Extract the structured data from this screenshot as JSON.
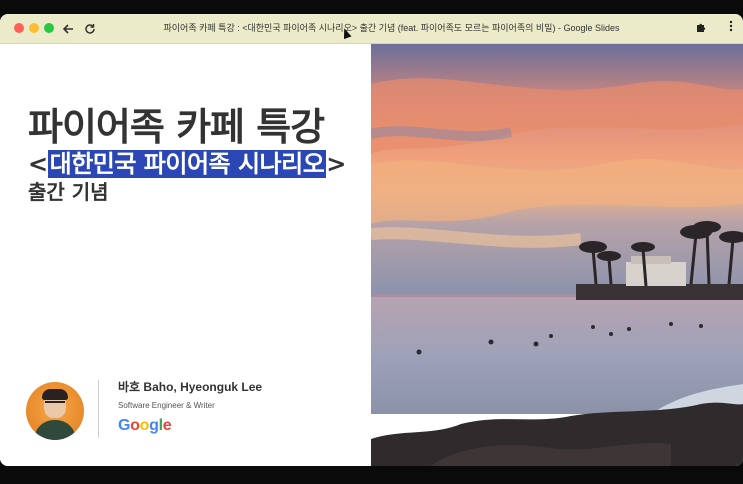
{
  "window": {
    "title": "파이어족 카페 특강 : <대한민국 파이어족 시나리오> 출간 기념 (feat. 파이어족도 모르는 파이어족의 비밀) - Google Slides"
  },
  "slide": {
    "title": "파이어족 카페  특강",
    "subtitle_highlight": "대한민국 파이어족 시나리오",
    "subtitle_open": "<",
    "subtitle_close": ">",
    "subtitle_line2": "출간 기념",
    "author": {
      "name": "바호 Baho, Hyeonguk Lee",
      "role": "Software Engineer & Writer",
      "company_logo": "Google"
    }
  },
  "icons": {
    "back": "arrow-left-icon",
    "reload": "reload-icon",
    "extensions": "puzzle-icon",
    "menu": "more-vert-icon"
  },
  "colors": {
    "titlebar": "#ecebc9",
    "highlight": "#2b47b5",
    "text": "#333333"
  }
}
